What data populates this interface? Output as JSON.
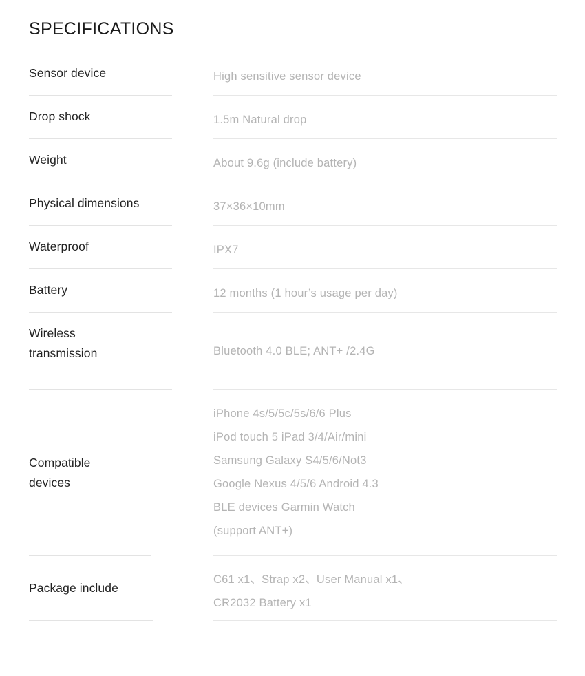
{
  "page": {
    "title": "SPECIFICATIONS",
    "accent_rule_color": "#b9b9b9",
    "divider_color": "#e3e3e3",
    "label_color": "#232323",
    "value_color": "#b4b4b4",
    "background": "#ffffff"
  },
  "specs": [
    {
      "label": "Sensor device",
      "value": "High sensitive sensor device"
    },
    {
      "label": "Drop shock",
      "value": "1.5m Natural drop"
    },
    {
      "label": "Weight",
      "value": "About 9.6g (include battery)"
    },
    {
      "label": "Physical dimensions",
      "value": "37×36×10mm"
    },
    {
      "label": "Waterproof",
      "value": "IPX7"
    },
    {
      "label": "Battery",
      "value": "12 months (1 hour’s usage per day)"
    },
    {
      "label": "Wireless\ntransmission",
      "value": "Bluetooth 4.0 BLE; ANT+ /2.4G"
    },
    {
      "label": "Compatible\ndevices",
      "value": "iPhone 4s/5/5c/5s/6/6 Plus\niPod touch 5 iPad 3/4/Air/mini\nSamsung Galaxy S4/5/6/Not3\nGoogle Nexus 4/5/6 Android 4.3\nBLE devices Garmin Watch\n(support ANT+)"
    },
    {
      "label": "Package include",
      "value": "C61 x1、Strap x2、User Manual x1、\nCR2032 Battery x1"
    }
  ]
}
